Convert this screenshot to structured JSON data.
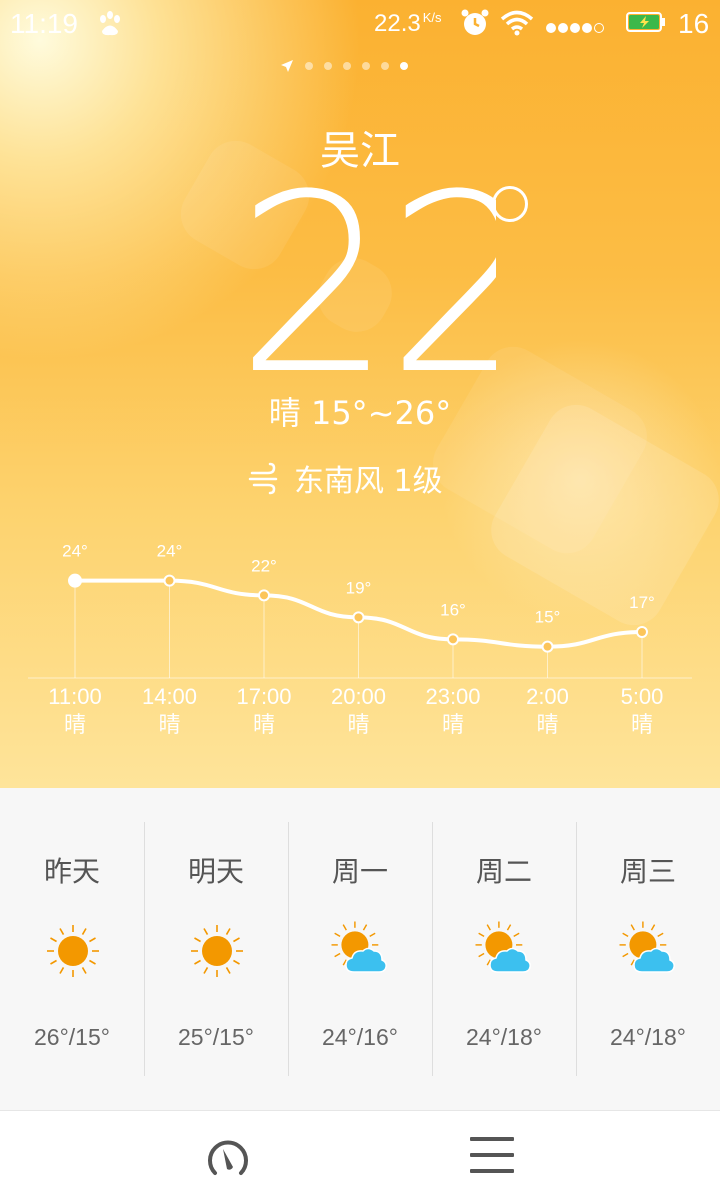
{
  "status_bar": {
    "time": "11:19",
    "net_speed": "22.3",
    "net_unit": "K/s",
    "battery_level": "16"
  },
  "pager": {
    "count": 6,
    "active_index": 5
  },
  "current": {
    "city": "吴江",
    "temperature": "22",
    "condition_range": "晴 15°~26°",
    "wind": "东南风 1级"
  },
  "chart_data": {
    "type": "line",
    "x": [
      "11:00",
      "14:00",
      "17:00",
      "20:00",
      "23:00",
      "2:00",
      "5:00"
    ],
    "conditions": [
      "晴",
      "晴",
      "晴",
      "晴",
      "晴",
      "晴",
      "晴"
    ],
    "series": [
      {
        "values": [
          24,
          24,
          22,
          19,
          16,
          15,
          17
        ],
        "labels": [
          "24°",
          "24°",
          "22°",
          "19°",
          "16°",
          "15°",
          "17°"
        ]
      }
    ],
    "ylim": [
      14,
      26
    ]
  },
  "forecast": [
    {
      "day": "昨天",
      "icon": "sun-icon",
      "range": "26°/15°"
    },
    {
      "day": "明天",
      "icon": "sun-icon",
      "range": "25°/15°"
    },
    {
      "day": "周一",
      "icon": "sun-cloud-icon",
      "range": "24°/16°"
    },
    {
      "day": "周二",
      "icon": "sun-cloud-icon",
      "range": "24°/18°"
    },
    {
      "day": "周三",
      "icon": "sun-cloud-icon",
      "range": "24°/18°"
    }
  ],
  "colors": {
    "sun": "#f39800",
    "cloud": "#3cc0ef",
    "background_top": "#fbb131",
    "background_bottom": "#fee49a"
  }
}
